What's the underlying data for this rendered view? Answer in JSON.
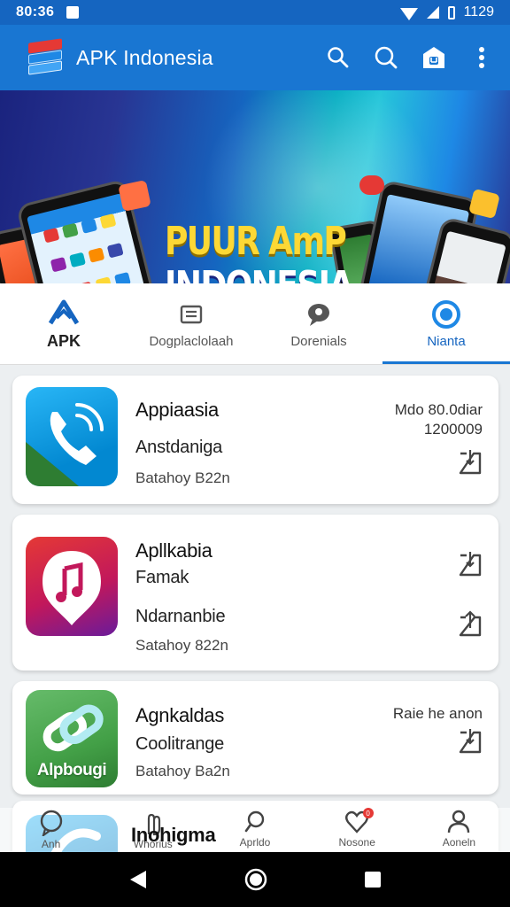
{
  "status_bar": {
    "time": "80:36",
    "right_text": "1129"
  },
  "app_bar": {
    "title": "APK Indonesia",
    "icons": [
      "search-icon",
      "search-icon",
      "store-icon",
      "more-icon"
    ]
  },
  "banner": {
    "line1": "PUUR AmP",
    "line2": "INDONESIA",
    "dots": 3,
    "active_dot": 2
  },
  "tabs": [
    {
      "label": "APK",
      "icon": "apk-logo-icon"
    },
    {
      "label": "Dogplaclolaah",
      "icon": "list-icon"
    },
    {
      "label": "Dorenials",
      "icon": "chat-icon"
    },
    {
      "label": "Nianta",
      "icon": "profile-ring-icon",
      "active": true
    }
  ],
  "apps": [
    {
      "title": "Appiaasia",
      "subtitle": "Anstdaniga",
      "meta": "Batahoy B22n",
      "right_line1": "Mdo 80.0diar",
      "right_line2": "1200009",
      "icon": "phone-icon"
    },
    {
      "title": "Apllkabia",
      "subtitle": "Famak",
      "subtitle2": "Ndarnanbie",
      "meta": "Satahoy 822n",
      "icon": "music-note-icon"
    },
    {
      "title": "Agnkaldas",
      "subtitle": "Coolitrange",
      "meta": "Batahoy Ba2n",
      "right_line1": "Raie he anon",
      "icon_caption": "Alpbougi",
      "icon": "chain-link-icon"
    },
    {
      "title": "Inohigma",
      "icon": "app-icon"
    }
  ],
  "bottom_nav": [
    {
      "label": "Anh",
      "icon": "chat-bubble-icon"
    },
    {
      "label": "Whorius",
      "icon": "hand-icon"
    },
    {
      "label": "Aprldo",
      "icon": "search-icon"
    },
    {
      "label": "Nosone",
      "icon": "heart-icon",
      "badge": "0"
    },
    {
      "label": "Aoneln",
      "icon": "person-icon"
    }
  ],
  "colors": {
    "primary": "#1976d2",
    "status_bar": "#1565c0",
    "accent": "#ff7043",
    "active_tab": "#1565c0"
  }
}
